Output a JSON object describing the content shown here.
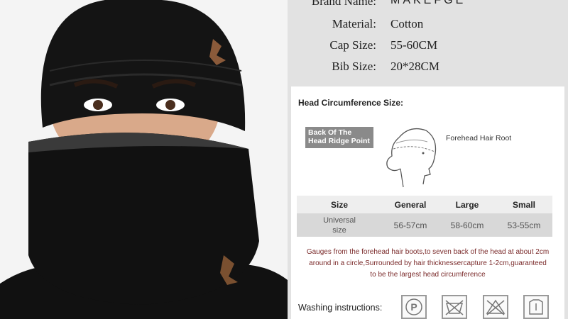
{
  "specs": {
    "brand_label": "Brand Name:",
    "brand_value": "MAKEFGE",
    "material_label": "Material:",
    "material_value": "Cotton",
    "cap_label": "Cap Size:",
    "cap_value": "55-60CM",
    "bib_label": "Bib Size:",
    "bib_value": "20*28CM"
  },
  "head": {
    "title": "Head Circumference Size:",
    "badge_line1": "Back Of The",
    "badge_line2": "Head Ridge Point",
    "forehead_label": "Forehead Hair Root"
  },
  "size_table": {
    "headers": [
      "Size",
      "General",
      "Large",
      "Small"
    ],
    "row": [
      "Universal size",
      "56-57cm",
      "58-60cm",
      "53-55cm"
    ]
  },
  "note": {
    "line1": "Gauges from the forehead hair boots,to seven back of the head at about 2cm",
    "line2": "around in a circle,Surrounded by hair thicknessercapture 1-2cm,guaranteed",
    "line3": "to be the largest head circumference"
  },
  "washing": {
    "label": "Washing instructions:",
    "icons": [
      "dry-clean-p-icon",
      "no-wash-icon",
      "no-bleach-icon",
      "hang-dry-icon"
    ]
  },
  "colors": {
    "background": "#e2e2e2",
    "badge": "#8a8a8a",
    "note_text": "#7a2a2a",
    "hat": "#141414"
  }
}
